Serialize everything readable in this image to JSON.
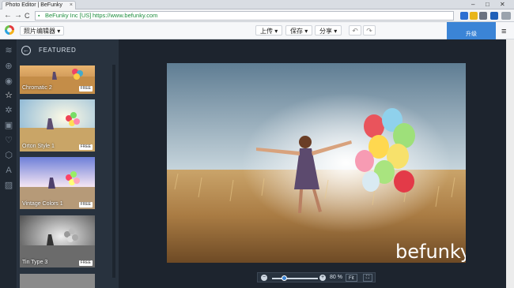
{
  "browser": {
    "tab_title": "Photo Editor | BeFunky",
    "tab_close": "×",
    "win_minimize": "–",
    "win_maximize": "□",
    "win_close": "✕",
    "back": "←",
    "forward": "→",
    "reload": "C",
    "ev_org": "BeFunky Inc [US]",
    "url": "https://www.befunky.com"
  },
  "app": {
    "mode_select": "照片编辑器 ▾",
    "menu": [
      {
        "label": "上传 ▾"
      },
      {
        "label": "保存 ▾"
      },
      {
        "label": "分享 ▾"
      }
    ],
    "undo": "↶",
    "redo": "↷",
    "upgrade_label": "升级",
    "hamburger": "≡"
  },
  "panel": {
    "back_glyph": "←",
    "title": "FEATURED",
    "effects": [
      {
        "name": "Chromatic 2",
        "badge": "FREE"
      },
      {
        "name": "Orton Style 1",
        "badge": "FREE"
      },
      {
        "name": "Vintage Colors 1",
        "badge": "FREE"
      },
      {
        "name": "Tin Type 3",
        "badge": "FREE"
      }
    ]
  },
  "rail": {
    "icons": [
      "layers-icon",
      "adjust-icon",
      "eye-icon",
      "star-icon",
      "gear-icon",
      "frame-icon",
      "heart-icon",
      "shape-icon",
      "text-icon",
      "texture-icon"
    ]
  },
  "zoom": {
    "minus": "−",
    "plus": "+",
    "value": "80 %",
    "level": 0.8,
    "fit_label": "Fit",
    "fullscreen": "⛶"
  },
  "watermark": {
    "pre": "b",
    "post": "efunky"
  }
}
